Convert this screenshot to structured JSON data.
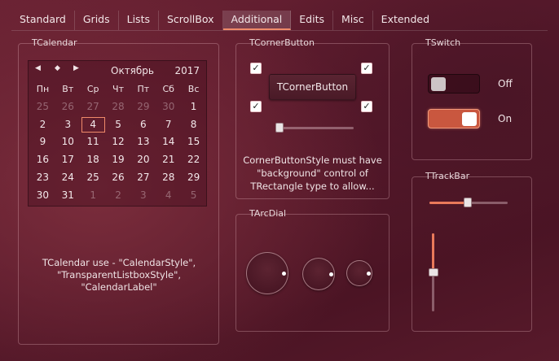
{
  "tabs": [
    {
      "label": "Standard",
      "active": false
    },
    {
      "label": "Grids",
      "active": false
    },
    {
      "label": "Lists",
      "active": false
    },
    {
      "label": "ScrollBox",
      "active": false
    },
    {
      "label": "Additional",
      "active": true
    },
    {
      "label": "Edits",
      "active": false
    },
    {
      "label": "Misc",
      "active": false
    },
    {
      "label": "Extended",
      "active": false
    }
  ],
  "calendar_group": {
    "title": "TCalendar",
    "nav": {
      "prev": "◀",
      "today": "◆",
      "next": "▶"
    },
    "month": "Октябрь",
    "year": "2017",
    "weekdays": [
      "Пн",
      "Вт",
      "Ср",
      "Чт",
      "Пт",
      "Сб",
      "Вс"
    ],
    "weeks": [
      [
        [
          "25",
          true
        ],
        [
          "26",
          true
        ],
        [
          "27",
          true
        ],
        [
          "28",
          true
        ],
        [
          "29",
          true
        ],
        [
          "30",
          true
        ],
        [
          "1",
          false
        ]
      ],
      [
        [
          "2",
          false
        ],
        [
          "3",
          false
        ],
        [
          "4",
          false
        ],
        [
          "5",
          false
        ],
        [
          "6",
          false
        ],
        [
          "7",
          false
        ],
        [
          "8",
          false
        ]
      ],
      [
        [
          "9",
          false
        ],
        [
          "10",
          false
        ],
        [
          "11",
          false
        ],
        [
          "12",
          false
        ],
        [
          "13",
          false
        ],
        [
          "14",
          false
        ],
        [
          "15",
          false
        ]
      ],
      [
        [
          "16",
          false
        ],
        [
          "17",
          false
        ],
        [
          "18",
          false
        ],
        [
          "19",
          false
        ],
        [
          "20",
          false
        ],
        [
          "21",
          false
        ],
        [
          "22",
          false
        ]
      ],
      [
        [
          "23",
          false
        ],
        [
          "24",
          false
        ],
        [
          "25",
          false
        ],
        [
          "26",
          false
        ],
        [
          "27",
          false
        ],
        [
          "28",
          false
        ],
        [
          "29",
          false
        ]
      ],
      [
        [
          "30",
          false
        ],
        [
          "31",
          false
        ],
        [
          "1",
          true
        ],
        [
          "2",
          true
        ],
        [
          "3",
          true
        ],
        [
          "4",
          true
        ],
        [
          "5",
          true
        ]
      ]
    ],
    "selected_day": "4",
    "note_line1": "TCalendar use - \"CalendarStyle\",",
    "note_line2": "\"TransparentListboxStyle\", \"CalendarLabel\""
  },
  "corner_group": {
    "title": "TCornerButton",
    "button_label": "TCornerButton",
    "checkbox_mark": "✓",
    "checkboxes_checked": [
      true,
      true,
      true,
      true
    ],
    "slider_value": 0,
    "note_line1": "CornerButtonStyle must have",
    "note_line2": "\"background\" control of",
    "note_line3": "TRectangle type to allow..."
  },
  "switch_group": {
    "title": "TSwitch",
    "off_label": "Off",
    "on_label": "On",
    "states": [
      false,
      true
    ]
  },
  "arcdial_group": {
    "title": "TArcDial"
  },
  "trackbar_group": {
    "title": "TTrackBar",
    "horizontal_value": 0.5,
    "vertical_value": 0.5
  },
  "colors": {
    "accent": "#f08a6a",
    "background": "#5a1a2c"
  }
}
